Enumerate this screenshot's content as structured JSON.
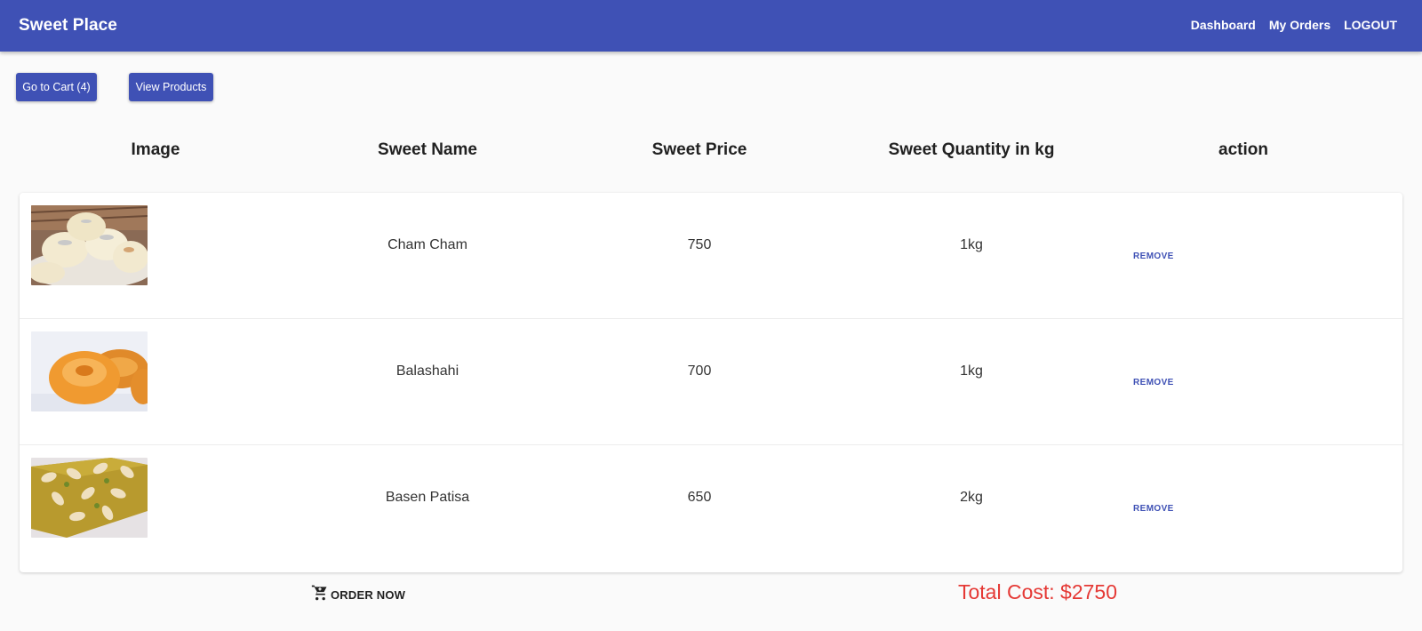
{
  "app": {
    "title": "Sweet Place",
    "nav": [
      "Dashboard",
      "My Orders",
      "LOGOUT"
    ],
    "accent_color": "#3f51b5"
  },
  "actions": {
    "cart_label": "Go to Cart (4)",
    "products_label": "View Products"
  },
  "table": {
    "headers": [
      "Image",
      "Sweet Name",
      "Sweet Price",
      "Sweet Quantity in kg",
      "action"
    ],
    "rows": [
      {
        "image": "cham-cham-image",
        "name": "Cham Cham",
        "price": "750",
        "quantity": "1kg",
        "action": "REMOVE"
      },
      {
        "image": "balashahi-image",
        "name": "Balashahi",
        "price": "700",
        "quantity": "1kg",
        "action": "REMOVE"
      },
      {
        "image": "basen-patisa-image",
        "name": "Basen Patisa",
        "price": "650",
        "quantity": "2kg",
        "action": "REMOVE"
      }
    ]
  },
  "footer": {
    "order_label": "ORDER NOW",
    "order_icon": "add-shopping-cart-icon",
    "total": "Total Cost: $2750",
    "total_color": "#e53935"
  }
}
